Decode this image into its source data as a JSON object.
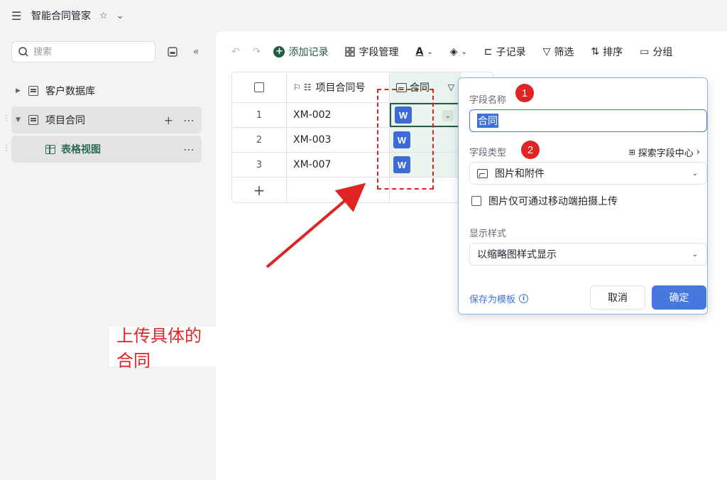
{
  "topbar": {
    "title": "智能合同管家",
    "star": "☆",
    "chevron": "⌄"
  },
  "sidebar": {
    "search_placeholder": "搜索",
    "items": [
      {
        "label": "客户数据库"
      },
      {
        "label": "项目合同"
      },
      {
        "label": "表格视图"
      }
    ]
  },
  "toolbar": {
    "add_record": "添加记录",
    "field_manage": "字段管理",
    "sub_record": "子记录",
    "filter": "筛选",
    "sort": "排序",
    "group": "分组"
  },
  "table": {
    "columns": [
      "项目合同号",
      "合同"
    ],
    "rows": [
      {
        "index": "1",
        "code": "XM-002",
        "attachment": "W"
      },
      {
        "index": "2",
        "code": "XM-003",
        "attachment": "W"
      },
      {
        "index": "3",
        "code": "XM-007",
        "attachment": "W"
      }
    ],
    "add_row": "+"
  },
  "annotation": {
    "text": "上传具体的合同",
    "badge1": "1",
    "badge2": "2"
  },
  "dialog": {
    "field_name_label": "字段名称",
    "field_name_value": "合同",
    "field_type_label": "字段类型",
    "explore_link": "探索字段中心",
    "field_type_value": "图片和附件",
    "mobile_only_label": "图片仅可通过移动端拍摄上传",
    "display_style_label": "显示样式",
    "display_style_value": "以缩略图样式显示",
    "save_template": "保存为模板",
    "cancel": "取消",
    "confirm": "确定"
  },
  "colors": {
    "accent": "#1f5e3f",
    "primary_button": "#4677df",
    "annotation_red": "#e02424"
  }
}
